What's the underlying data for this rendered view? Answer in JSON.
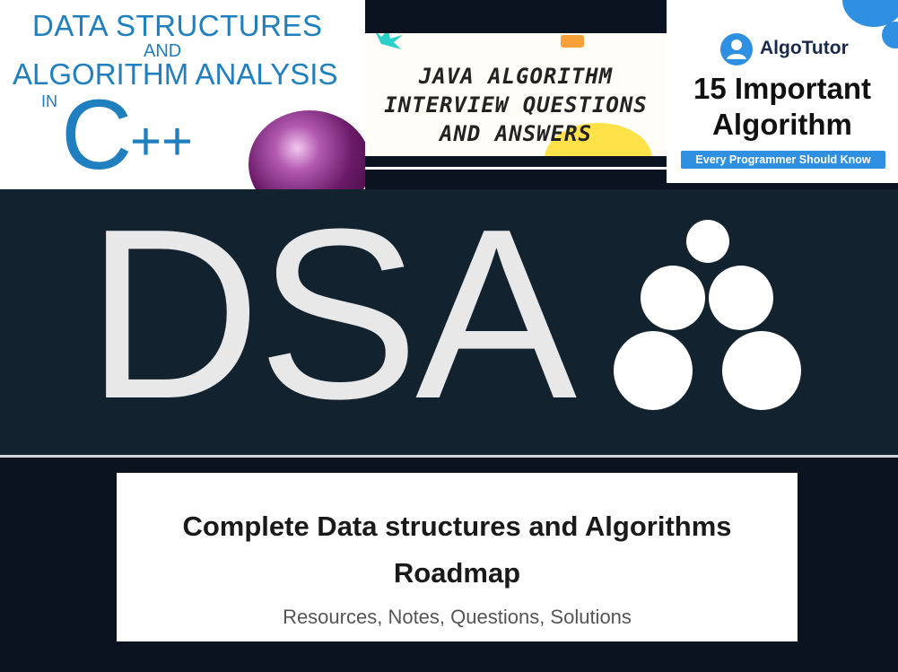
{
  "book_cover": {
    "line1": "DATA STRUCTURES",
    "line2": "AND",
    "line3": "ALGORITHM ANALYSIS",
    "line4": "IN",
    "lang_c": "C",
    "lang_pp": "++",
    "accent": "#1f7fbf"
  },
  "java_banner": {
    "line1": "JAVA ALGORITHM",
    "line2": "INTERVIEW QUESTIONS",
    "line3": "AND ANSWERS"
  },
  "algotutor": {
    "brand": "AlgoTutor",
    "heading_line1": "15 Important",
    "heading_line2": "Algorithm",
    "tagline": "Every Programmer Should Know",
    "accent": "#2f8fe0",
    "icon": "user-logo-icon"
  },
  "dsa_banner": {
    "word": "DSA",
    "background": "#12232f",
    "icon": "circles-pyramid-icon"
  },
  "roadmap_card": {
    "title_line1": "Complete Data structures and Algorithms",
    "title_line2": "Roadmap",
    "subtitle": "Resources, Notes, Questions, Solutions"
  }
}
